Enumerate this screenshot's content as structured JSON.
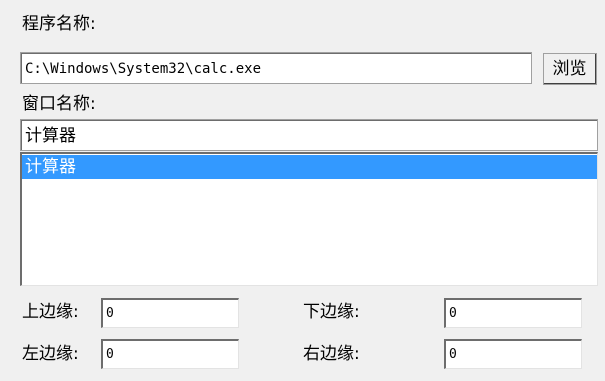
{
  "program": {
    "label": "程序名称:",
    "path_value": "C:\\Windows\\System32\\calc.exe",
    "browse_label": "浏览"
  },
  "window": {
    "label": "窗口名称:",
    "name_value": "计算器",
    "list_items": [
      "计算器"
    ],
    "selected_index": 0
  },
  "margins": {
    "top_label": "上边缘:",
    "top_value": "0",
    "bottom_label": "下边缘:",
    "bottom_value": "0",
    "left_label": "左边缘:",
    "left_value": "0",
    "right_label": "右边缘:",
    "right_value": "0"
  },
  "colors": {
    "background": "#f0f0f0",
    "selection": "#3399ff"
  }
}
